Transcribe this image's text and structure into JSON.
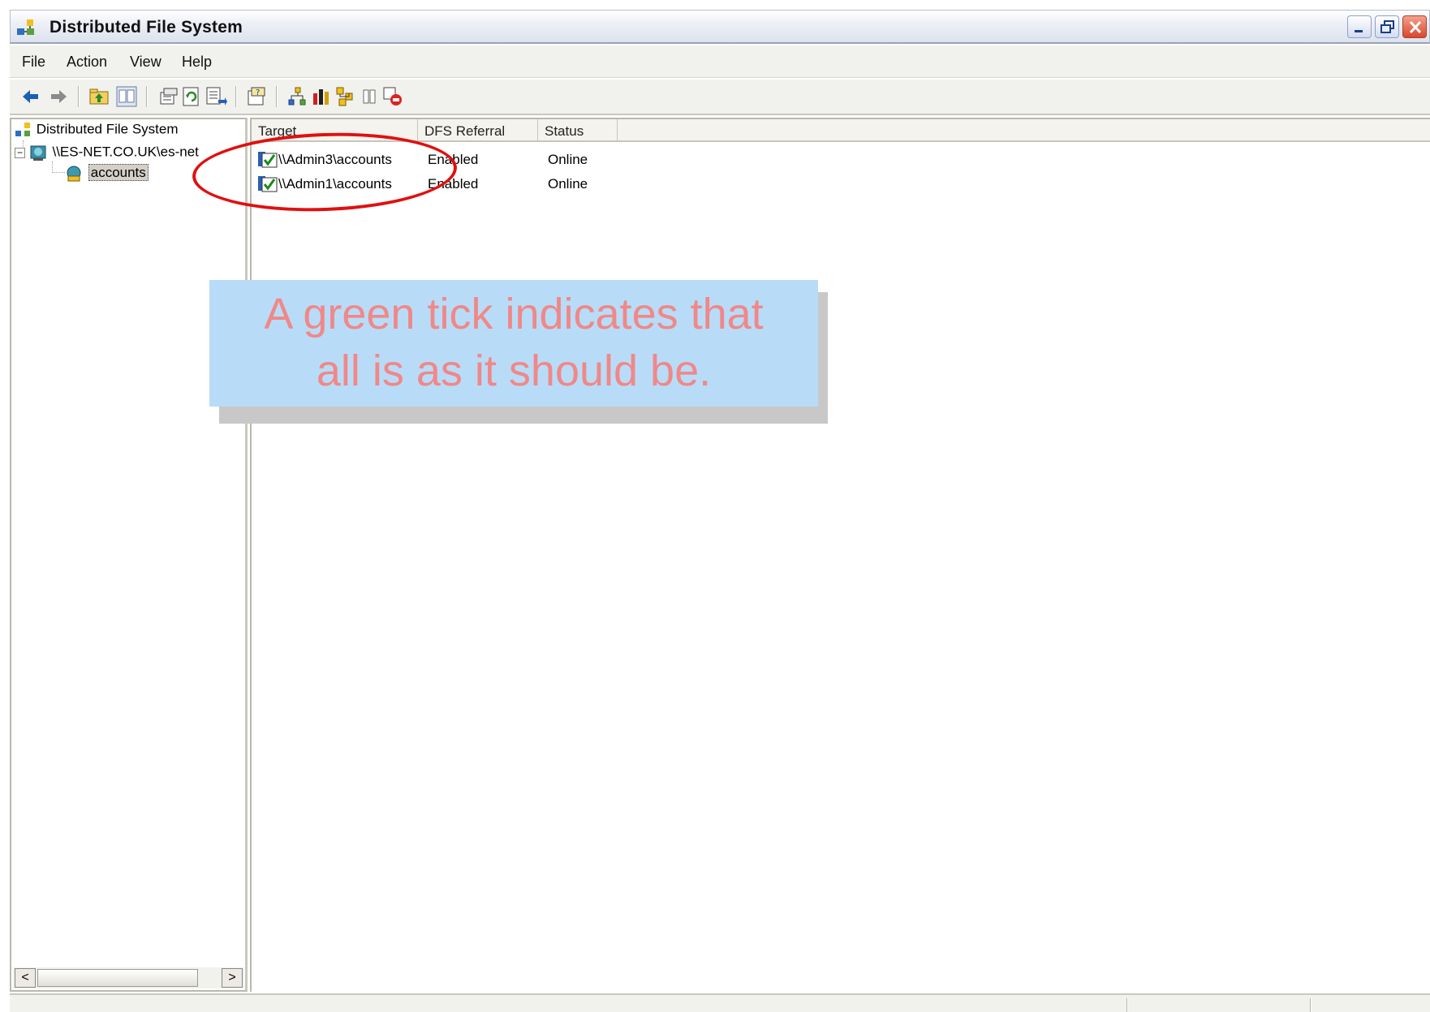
{
  "window": {
    "title": "Distributed File System",
    "controls": [
      "minimize",
      "restore",
      "close"
    ]
  },
  "menu": {
    "file": "File",
    "action": "Action",
    "view": "View",
    "help": "Help"
  },
  "toolbar": {
    "icons": [
      "back-arrow-icon",
      "forward-arrow-icon",
      "up-folder-icon",
      "show-hide-tree-icon",
      "properties-icon",
      "refresh-icon",
      "export-list-icon",
      "help-icon",
      "new-root-icon",
      "check-status-icon",
      "open-icon",
      "filter-icon",
      "stop-icon"
    ]
  },
  "tree": {
    "root_label": "Distributed File System",
    "domain_label": "\\\\ES-NET.CO.UK\\es-net",
    "link_label": "accounts"
  },
  "list": {
    "columns": [
      "Target",
      "DFS Referral",
      "Status"
    ],
    "rows": [
      {
        "target": "\\\\Admin3\\accounts",
        "referral": "Enabled",
        "status": "Online"
      },
      {
        "target": "\\\\Admin1\\accounts",
        "referral": "Enabled",
        "status": "Online"
      }
    ]
  },
  "callout": {
    "line1": "A green tick indicates that",
    "line2": "all is as it should be."
  },
  "colors": {
    "callout_bg": "#b8dcf8",
    "callout_text": "#f08888",
    "highlight": "#e01010"
  }
}
